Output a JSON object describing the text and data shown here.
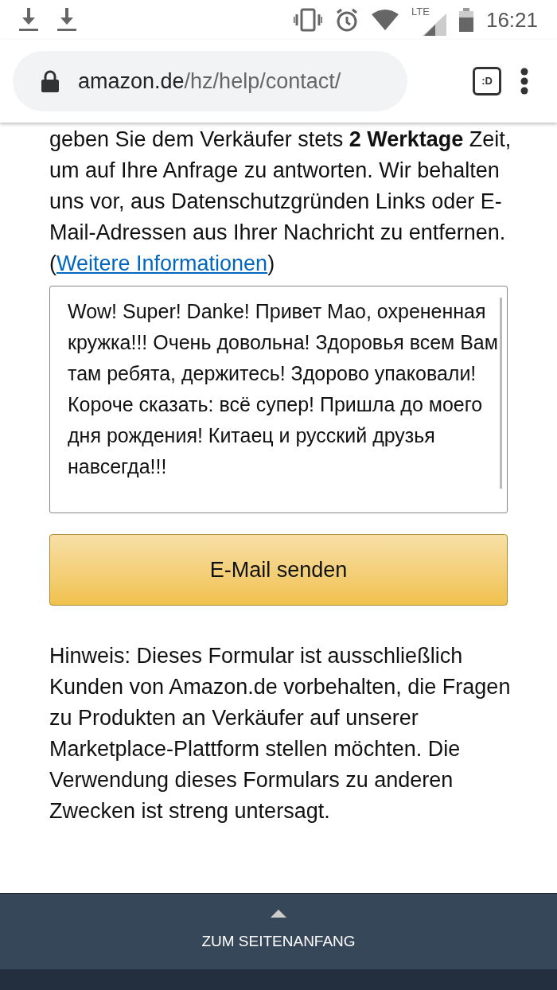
{
  "status_bar": {
    "network": "LTE",
    "time": "16:21"
  },
  "browser": {
    "url_domain": "amazon.de",
    "url_path": "/hz/help/contact/",
    "tab_badge": ":D"
  },
  "intro": {
    "text": "geben Sie dem Verkäufer stets **2 Werktage** Zeit, um auf Ihre Anfrage zu antworten. Wir behalten uns vor, aus Datenschutzgründen Links oder E-Mail-Adressen aus Ihrer Nachricht zu entfernen. (",
    "link": "Weitere Informationen",
    "after": ")"
  },
  "message": {
    "value": "Wow! Super! Danke! Привет Мао, охрененная кружка!!! Очень довольна! Здоровья всем Вам там ребята, держитесь! Здорово упаковали! Короче сказать: всё супер! Пришла до моего дня рождения! Китаец и русский друзья навсегда!!!"
  },
  "send_button": "E-Mail senden",
  "note": "Hinweis: Dieses Formular ist ausschließlich Kunden von Amazon.de vorbehalten, die Fragen zu Produkten an Verkäufer auf unserer Marketplace-Plattform stellen möchten. Die Verwendung dieses Formulars zu anderen Zwecken ist streng untersagt.",
  "footer": {
    "back_to_top": "ZUM SEITENANFANG"
  }
}
